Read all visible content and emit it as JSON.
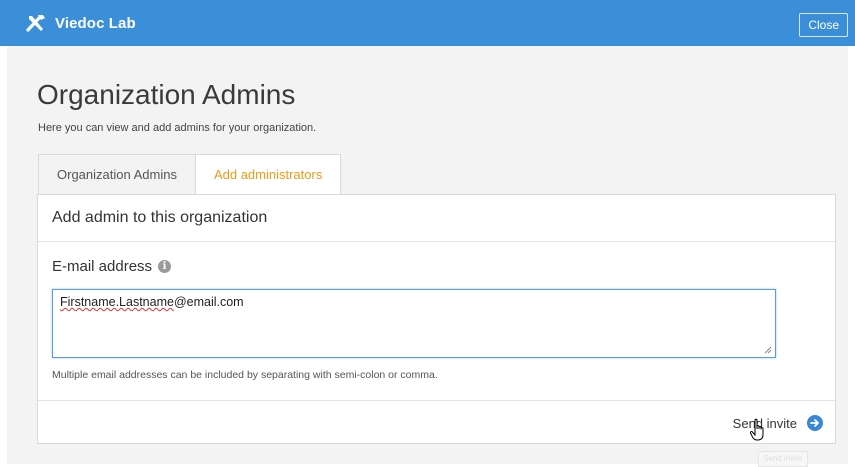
{
  "app": {
    "name": "Viedoc Lab",
    "close_label": "Close",
    "accent_color": "#3b8fd9"
  },
  "page": {
    "title": "Organization Admins",
    "description": "Here you can view and add admins for your organization."
  },
  "tabs": [
    {
      "label": "Organization Admins",
      "active": false
    },
    {
      "label": "Add administrators",
      "active": true
    }
  ],
  "panel": {
    "header": "Add admin to this organization",
    "field_label": "E-mail address",
    "field_icon": "info-icon",
    "email_value_name": "Firstname.Lastname",
    "email_value_domain": "@email.com",
    "help_text": "Multiple email addresses can be included by separating with semi-colon or comma.",
    "send_label": "Send invite",
    "send_icon": "arrow-right-circle-icon",
    "ghost_label": "Send invite"
  }
}
